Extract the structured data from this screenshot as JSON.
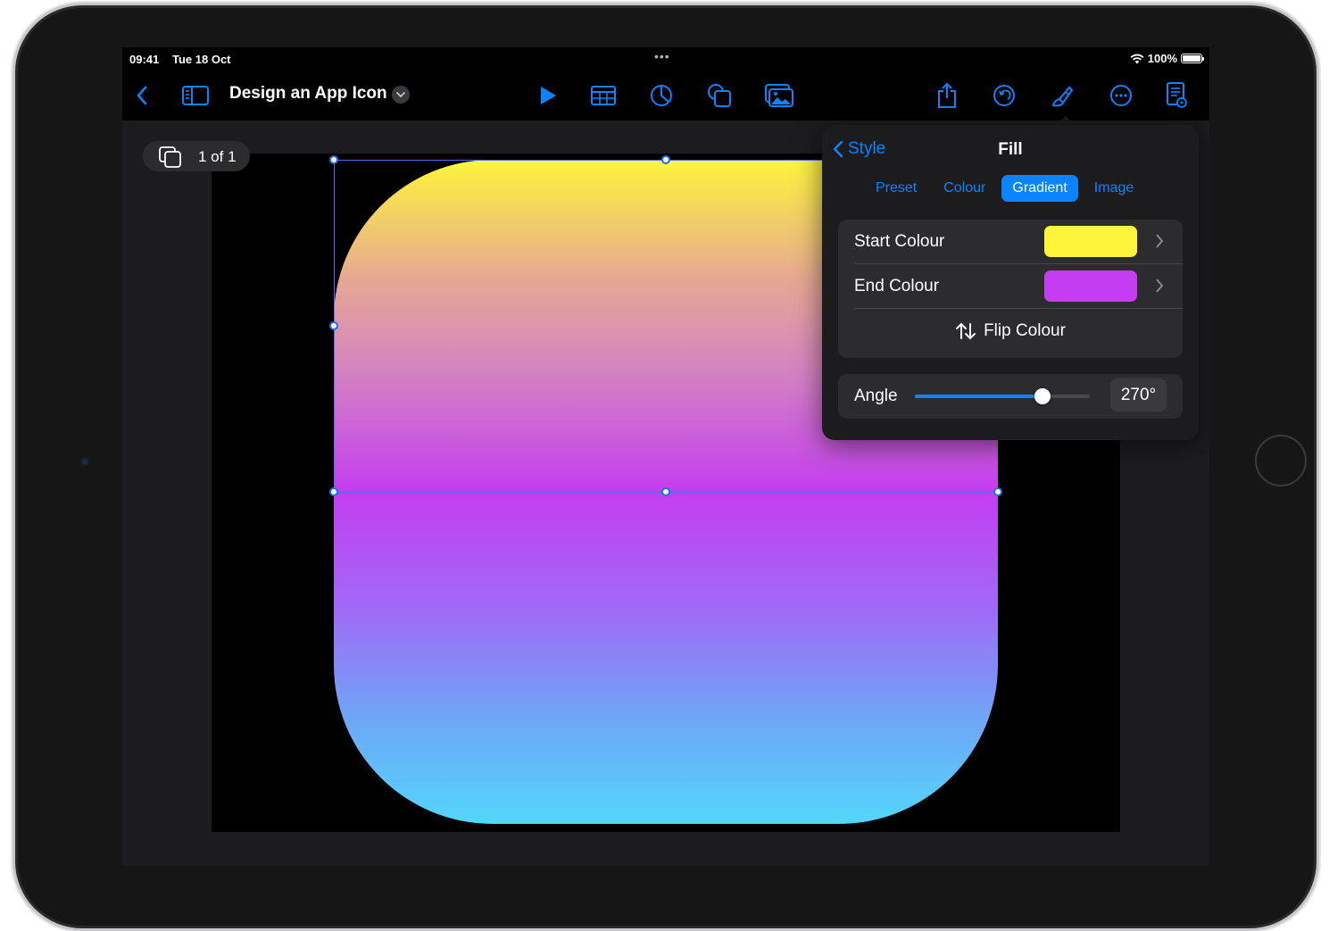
{
  "status_bar": {
    "time": "09:41",
    "date": "Tue 18 Oct",
    "battery": "100%"
  },
  "toolbar": {
    "document_title": "Design an App Icon"
  },
  "canvas": {
    "page_indicator": "1 of 1",
    "shape_gradient": {
      "start_colour": "#fdf53b",
      "end_colour": "#c43df0",
      "bottom_colour": "#53d6fb"
    }
  },
  "popover": {
    "back_label": "Style",
    "title": "Fill",
    "tabs": [
      {
        "label": "Preset",
        "active": false
      },
      {
        "label": "Colour",
        "active": false
      },
      {
        "label": "Gradient",
        "active": true
      },
      {
        "label": "Image",
        "active": false
      }
    ],
    "start_colour_label": "Start Colour",
    "start_colour_value": "#fdf53b",
    "end_colour_label": "End Colour",
    "end_colour_value": "#c43df0",
    "flip_label": "Flip Colour",
    "angle_label": "Angle",
    "angle_value": "270°",
    "angle_slider_fraction": 0.73
  },
  "colors": {
    "accent": "#0a84ff",
    "selection": "#1e6fe6"
  },
  "icons": [
    "back-chevron-icon",
    "sidebar-icon",
    "play-icon",
    "table-icon",
    "chart-icon",
    "shapes-icon",
    "media-icon",
    "share-icon",
    "undo-icon",
    "format-brush-icon",
    "more-icon",
    "document-icon",
    "copy-pages-icon",
    "flip-arrows-icon",
    "wifi-icon",
    "battery-icon"
  ]
}
